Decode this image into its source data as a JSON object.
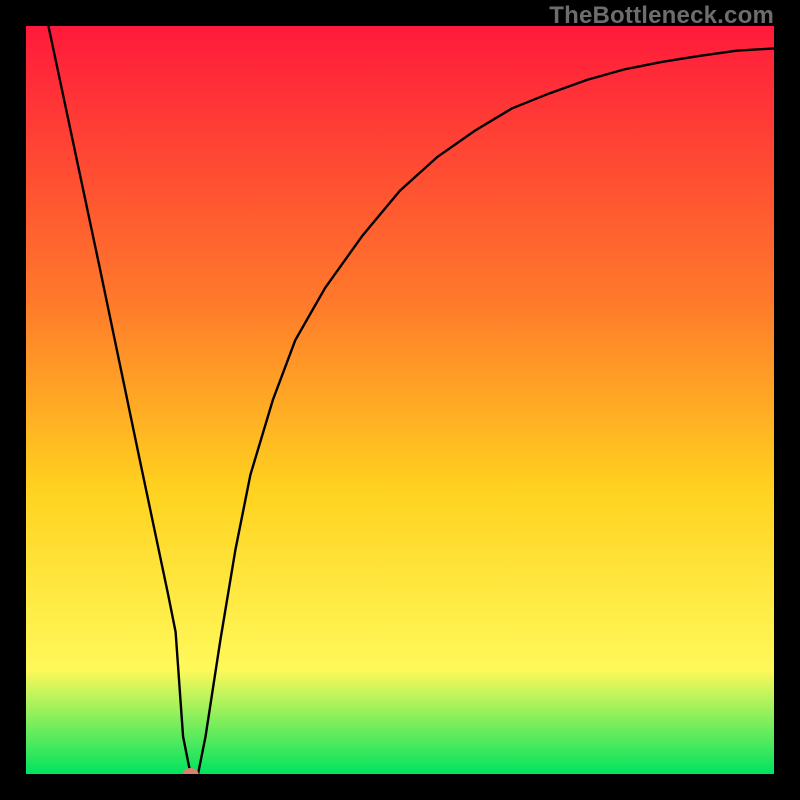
{
  "watermark": "TheBottleneck.com",
  "chart_data": {
    "type": "line",
    "title": "",
    "xlabel": "",
    "ylabel": "",
    "xlim": [
      0,
      100
    ],
    "ylim": [
      0,
      100
    ],
    "background_gradient": {
      "top": "#ff1a3b",
      "upper_mid": "#ff7a2b",
      "mid": "#ffd21f",
      "lower_mid": "#fff95a",
      "bottom": "#00e35f"
    },
    "marker": {
      "x": 22,
      "y": 0,
      "color": "#d9816d"
    },
    "series": [
      {
        "name": "curve",
        "x": [
          3,
          10,
          15,
          19,
          20,
          21,
          22,
          23,
          24,
          26,
          28,
          30,
          33,
          36,
          40,
          45,
          50,
          55,
          60,
          65,
          70,
          75,
          80,
          85,
          90,
          95,
          100
        ],
        "y": [
          100,
          67,
          43,
          24,
          19,
          5,
          0,
          0,
          5,
          18,
          30,
          40,
          50,
          58,
          65,
          72,
          78,
          82.5,
          86,
          89,
          91,
          92.8,
          94.2,
          95.2,
          96,
          96.7,
          97
        ]
      }
    ]
  }
}
